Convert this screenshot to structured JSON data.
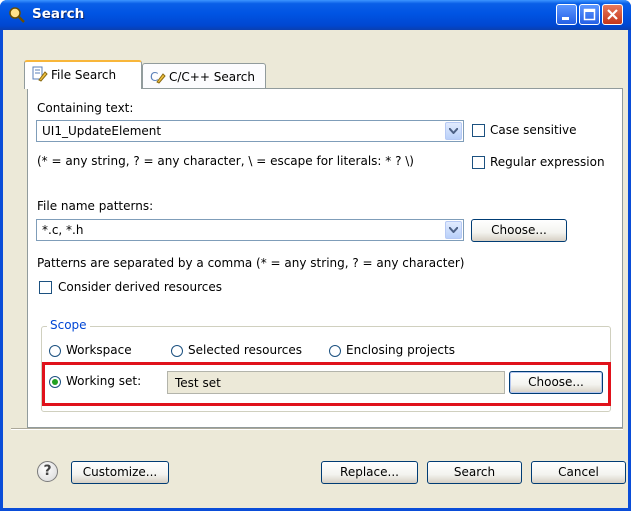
{
  "window": {
    "title": "Search"
  },
  "tabs": [
    {
      "label": "File Search",
      "active": true
    },
    {
      "label": "C/C++ Search",
      "active": false
    }
  ],
  "containing_text": {
    "label": "Containing text:",
    "value": "UI1_UpdateElement",
    "case_sensitive_label": "Case sensitive",
    "regex_label": "Regular expression",
    "hint": "(* = any string, ? = any character, \\ = escape for literals: * ? \\)"
  },
  "file_patterns": {
    "label": "File name patterns:",
    "value": "*.c, *.h",
    "choose_label": "Choose...",
    "hint": "Patterns are separated by a comma (* = any string, ? = any character)"
  },
  "derived": {
    "label": "Consider derived resources"
  },
  "scope": {
    "legend": "Scope",
    "workspace": "Workspace",
    "selected": "Selected resources",
    "enclosing": "Enclosing projects",
    "working_set_label": "Working set:",
    "working_set_value": "Test set",
    "choose_label": "Choose..."
  },
  "footer": {
    "help_glyph": "?",
    "customize": "Customize...",
    "replace": "Replace...",
    "search": "Search",
    "cancel": "Cancel"
  },
  "colors": {
    "titlebar": "#0054e3",
    "highlight": "#e0121b",
    "accent_tab": "#f8b63a",
    "dialog_bg": "#ece9d8"
  }
}
